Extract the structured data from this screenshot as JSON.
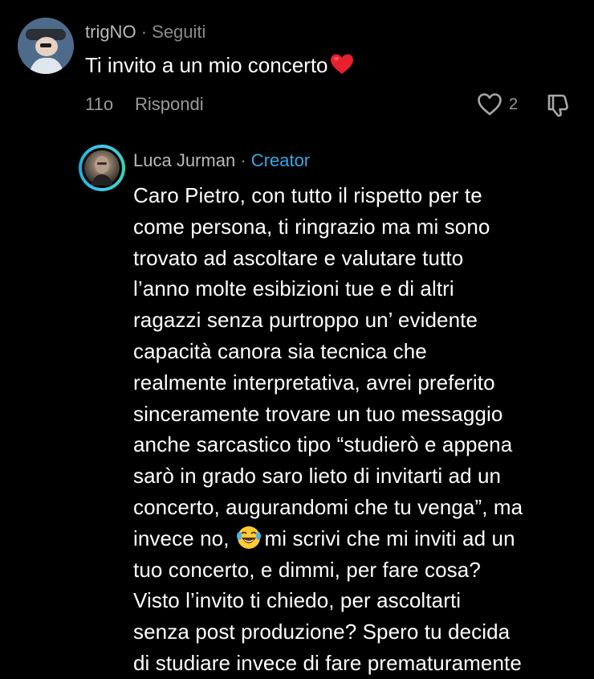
{
  "comment": {
    "username": "trigNO",
    "separator": "·",
    "relation": "Seguiti",
    "text": "Ti invito a un mio concerto",
    "emoji": "red-heart",
    "time": "11o",
    "reply_label": "Rispondi",
    "likes": "2"
  },
  "reply": {
    "username": "Luca Jurman",
    "separator": "·",
    "badge": "Creator",
    "lines": [
      "Caro Pietro, con tutto il rispetto per te",
      "come persona, ti ringrazio ma mi sono",
      "trovato ad ascoltare e valutare tutto",
      "l’anno molte esibizioni tue e di altri",
      "ragazzi senza purtroppo un’ evidente",
      "capacità canora sia tecnica che",
      "realmente interpretativa, avrei preferito",
      "sinceramente trovare un tuo messaggio",
      "anche sarcastico tipo “studierò e appena",
      "sarò in grado saro lieto di invitarti ad un",
      "concerto, augurandomi che tu venga”, ma",
      "invece no,",
      "mi scrivi che mi inviti ad un",
      "tuo concerto, e dimmi, per fare cosa?",
      "Visto l’invito ti chiedo, per ascoltarti",
      "senza post produzione? Spero tu decida",
      "di studiare invece di fare prematuramente"
    ],
    "emoji": "face-with-tears-of-joy"
  },
  "colors": {
    "background": "#000000",
    "creator_accent": "#31a8e6",
    "muted": "#9a9a9a",
    "heart": "#e8202e"
  }
}
